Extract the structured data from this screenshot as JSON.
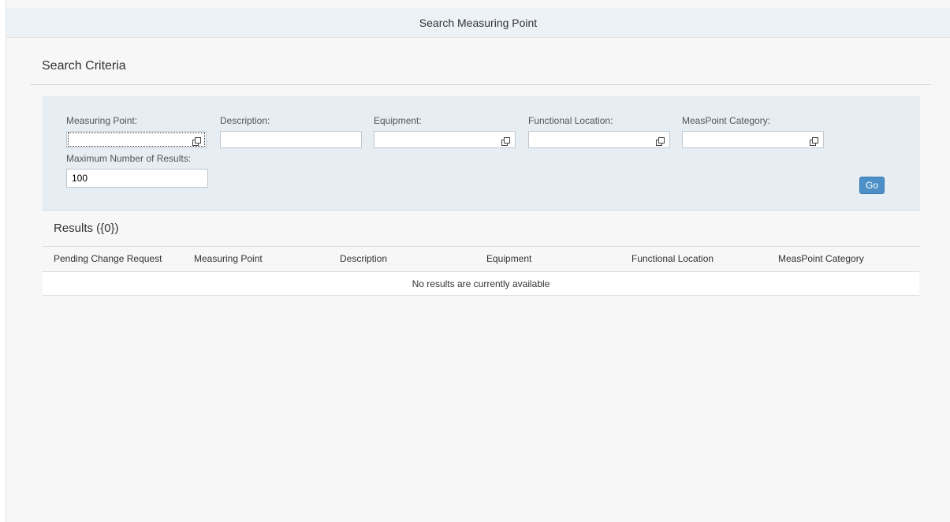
{
  "header": {
    "title": "Search Measuring Point"
  },
  "criteria": {
    "title": "Search Criteria"
  },
  "filters": [
    {
      "label": "Measuring Point:",
      "value": "",
      "icon": "value-help-icon"
    },
    {
      "label": "Description:",
      "value": ""
    },
    {
      "label": "Equipment:",
      "value": "",
      "icon": "value-help-icon"
    },
    {
      "label": "Functional Location:",
      "value": "",
      "icon": "value-help-icon"
    },
    {
      "label": "MeasPoint Category:",
      "value": "",
      "icon": "value-help-icon"
    }
  ],
  "max_results": {
    "label": "Maximum Number of Results:",
    "value": "100"
  },
  "go_label": "Go",
  "results": {
    "title": "Results ({0})",
    "columns": [
      "Pending Change Request",
      "Measuring Point",
      "Description",
      "Equipment",
      "Functional Location",
      "MeasPoint Category"
    ],
    "empty_text": "No results are currently available"
  }
}
